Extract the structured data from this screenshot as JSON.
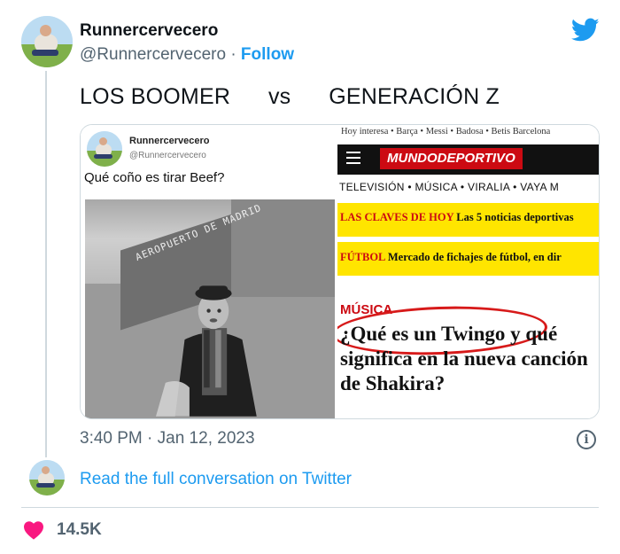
{
  "author": {
    "name": "Runnercervecero",
    "handle": "@Runnercervecero",
    "separator": "·",
    "follow_label": "Follow"
  },
  "tweet": {
    "text": "LOS BOOMER      vs      GENERACIÓN Z",
    "timestamp": "3:40 PM · Jan 12, 2023"
  },
  "media": {
    "left": {
      "name": "Runnercervecero",
      "handle": "@Runnercervecero",
      "question": "Qué coño es tirar Beef?",
      "sign_text": "AEROPUERTO DE MADRID"
    },
    "right": {
      "topnav": "Hoy interesa • Barça • Messi • Badosa • Betis Barcelona",
      "logo": "MUNDODEPORTIVO",
      "menu": "TELEVISIÓN  •  MÚSICA  •  VIRALIA  •  VAYA M",
      "claves_label": "LAS CLAVES DE HOY",
      "claves_text": " Las 5 noticias deportivas",
      "futbol_label": "FÚTBOL",
      "futbol_text": " Mercado de fichajes de fútbol, en dir",
      "section": "MÚSICA",
      "headline": "¿Qué es un Twingo y qué significa en la nueva canción de Shakira?"
    }
  },
  "footer": {
    "read_link": "Read the full conversation on Twitter",
    "likes": "14.5K"
  },
  "colors": {
    "twitter_blue": "#1d9bf0",
    "heart_red": "#f91880",
    "md_red": "#cc0a12",
    "md_yellow": "#ffe500"
  },
  "icons": [
    "twitter-bird-icon",
    "info-icon",
    "heart-icon"
  ]
}
